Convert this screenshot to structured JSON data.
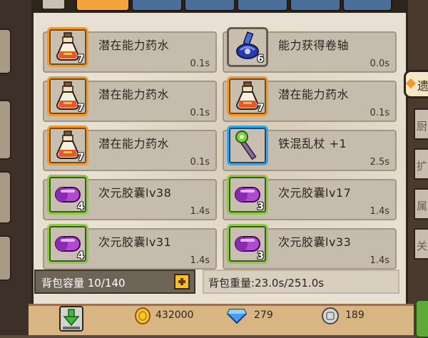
{
  "items": [
    {
      "name": "潜在能力药水",
      "count": "7",
      "time": "0.1s",
      "rarity": "orange",
      "icon": "potion-icon"
    },
    {
      "name": "能力获得卷轴",
      "count": "6",
      "time": "0.0s",
      "rarity": "plain",
      "icon": "scroll-icon"
    },
    {
      "name": "潜在能力药水",
      "count": "7",
      "time": "0.1s",
      "rarity": "orange",
      "icon": "potion-icon"
    },
    {
      "name": "潜在能力药水",
      "count": "7",
      "time": "0.1s",
      "rarity": "orange",
      "icon": "potion-icon"
    },
    {
      "name": "潜在能力药水",
      "count": "7",
      "time": "0.1s",
      "rarity": "orange",
      "icon": "potion-icon"
    },
    {
      "name": "铁混乱杖 +1",
      "count": "",
      "time": "2.5s",
      "rarity": "blue",
      "icon": "staff-icon"
    },
    {
      "name": "次元胶囊lv38",
      "count": "4",
      "time": "1.4s",
      "rarity": "green",
      "icon": "capsule-icon"
    },
    {
      "name": "次元胶囊lv17",
      "count": "3",
      "time": "1.4s",
      "rarity": "green",
      "icon": "capsule-icon"
    },
    {
      "name": "次元胶囊lv31",
      "count": "4",
      "time": "1.4s",
      "rarity": "green",
      "icon": "capsule-icon"
    },
    {
      "name": "次元胶囊lv33",
      "count": "3",
      "time": "1.4s",
      "rarity": "green",
      "icon": "capsule-icon"
    }
  ],
  "capacity_label": "背包容量 10/140",
  "weight_label": "背包重量:23.0s/251.0s",
  "currency": {
    "gold": "432000",
    "gems": "279",
    "silver": "189"
  },
  "side_tabs": [
    "遗",
    "厨",
    "扩",
    "属",
    "关"
  ],
  "colors": {
    "orange": "#f19a2c",
    "blue": "#3aa6e6",
    "green": "#8fc94a"
  }
}
